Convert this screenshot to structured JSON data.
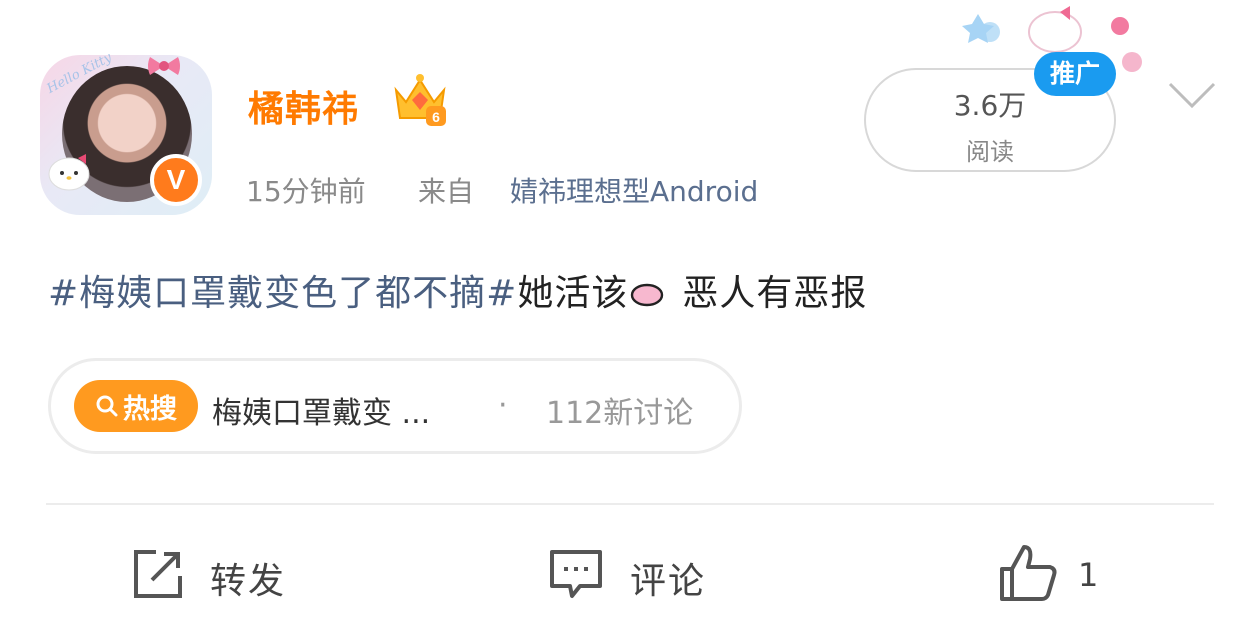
{
  "post": {
    "username": "橘韩祎",
    "level_badge": "6",
    "verified_mark": "V",
    "time": "15分钟前",
    "from_label": "来自",
    "source": "婧祎理想型Android",
    "hashtag": "#梅姨口罩戴变色了都不摘#",
    "text_part1": "她活该",
    "text_part2": "恶人有恶报",
    "avatar_text": "Hello Kitty"
  },
  "stats": {
    "read_count": "3.6万",
    "read_label": "阅读",
    "ad_label": "推广"
  },
  "hot_search": {
    "tag_label": "热搜",
    "title": "梅姨口罩戴变 ...",
    "separator": "·",
    "count": "112新讨论"
  },
  "actions": {
    "repost_label": "转发",
    "comment_label": "评论",
    "like_count": "1"
  },
  "colors": {
    "username": "#ff7a00",
    "hashtag": "#4a5f80",
    "hot_tag": "#ff9a1f",
    "ad_badge": "#1a9bf0",
    "verified": "#ff7b1c"
  },
  "icons": [
    "search-icon",
    "crown-icon",
    "heart-icon",
    "repost-icon",
    "comment-icon",
    "like-icon",
    "chevron-down-icon"
  ]
}
